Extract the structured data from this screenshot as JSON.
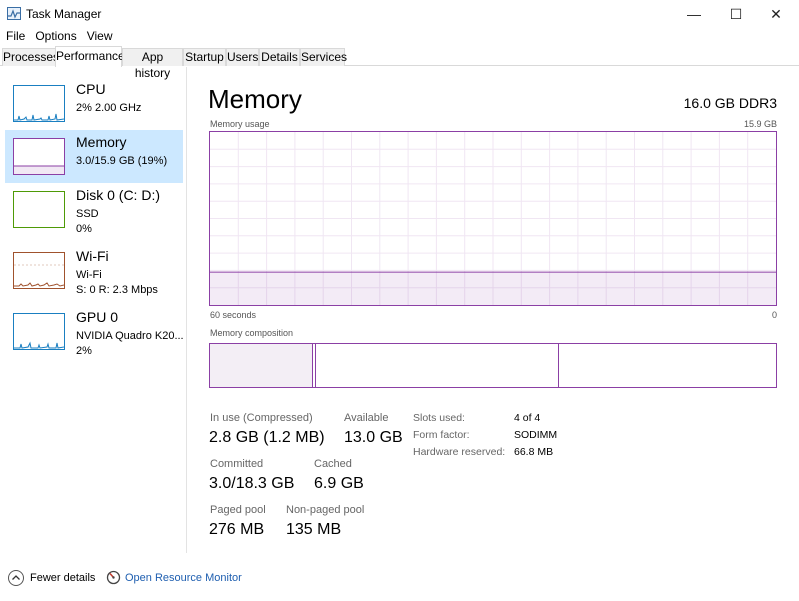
{
  "window": {
    "title": "Task Manager",
    "minimize_glyph": "—",
    "maximize_glyph": "☐",
    "close_glyph": "✕"
  },
  "menu": [
    "File",
    "Options",
    "View"
  ],
  "tabs": [
    "Processes",
    "Performance",
    "App history",
    "Startup",
    "Users",
    "Details",
    "Services"
  ],
  "active_tab": "Performance",
  "sidebar": {
    "items": [
      {
        "name": "CPU",
        "lines": [
          "2%  2.00 GHz"
        ],
        "color": "#1a7fc1"
      },
      {
        "name": "Memory",
        "lines": [
          "3.0/15.9 GB (19%)"
        ],
        "color": "#8b3fa5"
      },
      {
        "name": "Disk 0 (C: D:)",
        "lines": [
          "SSD",
          "0%"
        ],
        "color": "#4e9a06"
      },
      {
        "name": "Wi-Fi",
        "lines": [
          "Wi-Fi",
          "S: 0  R: 2.3 Mbps"
        ],
        "color": "#a0522d"
      },
      {
        "name": "GPU 0",
        "lines": [
          "NVIDIA Quadro K20...",
          "2%"
        ],
        "color": "#1a7fc1"
      }
    ],
    "selected": "Memory"
  },
  "main": {
    "title": "Memory",
    "spec": "16.0 GB DDR3",
    "usage_label": "Memory usage",
    "usage_max": "15.9 GB",
    "time_left": "60 seconds",
    "time_right": "0",
    "composition_label": "Memory composition",
    "accent_color": "#8b3fa5",
    "usage_fraction": 0.19
  },
  "stats": {
    "in_use_label": "In use (Compressed)",
    "in_use_value": "2.8 GB (1.2 MB)",
    "available_label": "Available",
    "available_value": "13.0 GB",
    "committed_label": "Committed",
    "committed_value": "3.0/18.3 GB",
    "cached_label": "Cached",
    "cached_value": "6.9 GB",
    "paged_label": "Paged pool",
    "paged_value": "276 MB",
    "nonpaged_label": "Non-paged pool",
    "nonpaged_value": "135 MB"
  },
  "details": {
    "slots_label": "Slots used:",
    "slots_value": "4 of 4",
    "form_label": "Form factor:",
    "form_value": "SODIMM",
    "reserved_label": "Hardware reserved:",
    "reserved_value": "66.8 MB"
  },
  "footer": {
    "fewer_details": "Fewer details",
    "resource_monitor": "Open Resource Monitor"
  }
}
